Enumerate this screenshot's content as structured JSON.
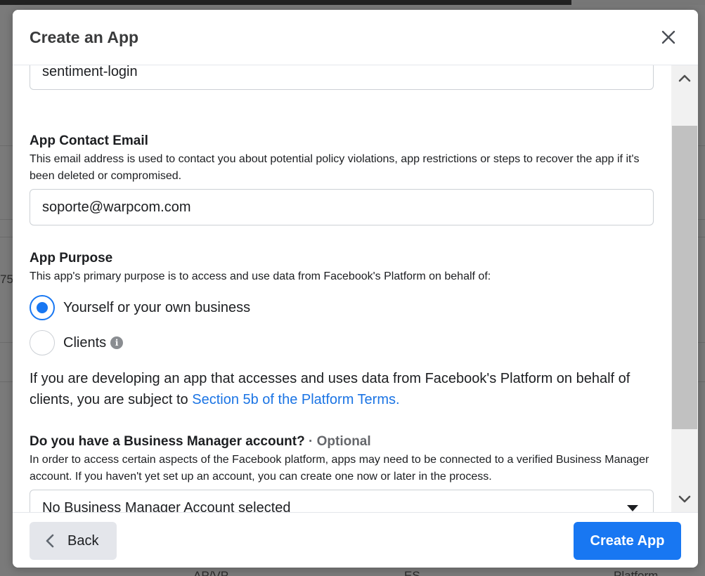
{
  "background": {
    "fragments": [
      "75",
      "AP/VP",
      "ES",
      "Platform"
    ]
  },
  "modal": {
    "title": "Create an App",
    "close_icon": "close-icon"
  },
  "form": {
    "app_name_value": "sentiment-login",
    "contact_email": {
      "title": "App Contact Email",
      "helper": "This email address is used to contact you about potential policy violations, app restrictions or steps to recover the app if it's been deleted or compromised.",
      "value": "soporte@warpcom.com"
    },
    "purpose": {
      "title": "App Purpose",
      "helper": "This app's primary purpose is to access and use data from Facebook's Platform on behalf of:",
      "options": [
        {
          "label": "Yourself or your own business",
          "selected": true
        },
        {
          "label": "Clients",
          "selected": false,
          "info_icon": "info-icon"
        }
      ],
      "note_prefix": "If you are developing an app that accesses and uses data from Facebook's Platform on behalf of clients, you are subject to ",
      "note_link": "Section 5b of the Platform Terms."
    },
    "business_manager": {
      "title": "Do you have a Business Manager account?",
      "optional": "· Optional",
      "helper": "In order to access certain aspects of the Facebook platform, apps may need to be connected to a verified Business Manager account. If you haven't yet set up an account, you can create one now or later in the process.",
      "selected_value": "No Business Manager Account selected"
    }
  },
  "footer": {
    "back_label": "Back",
    "create_label": "Create App"
  },
  "colors": {
    "accent": "#1877f2",
    "link": "#1b74e4"
  }
}
